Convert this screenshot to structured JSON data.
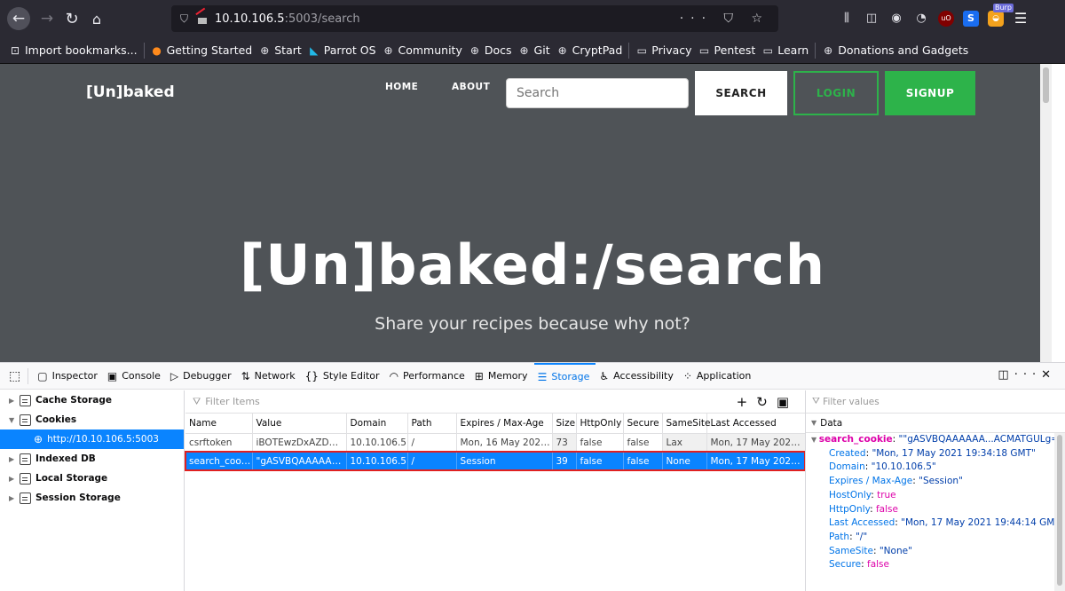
{
  "browser": {
    "url_host": "10.10.106.5",
    "url_rest": ":5003/search",
    "url_actions": "··· ⛉ ☆",
    "burp_badge": "Burp",
    "bookmarks": [
      {
        "label": "Import bookmarks...",
        "icon": "import-icon"
      },
      {
        "label": "Getting Started",
        "icon": "firefox-icon"
      },
      {
        "label": "Start",
        "icon": "globe-icon"
      },
      {
        "label": "Parrot OS",
        "icon": "parrot-icon"
      },
      {
        "label": "Community",
        "icon": "globe-icon"
      },
      {
        "label": "Docs",
        "icon": "globe-icon"
      },
      {
        "label": "Git",
        "icon": "globe-icon"
      },
      {
        "label": "CryptPad",
        "icon": "globe-icon"
      },
      {
        "label": "Privacy",
        "icon": "folder-icon"
      },
      {
        "label": "Pentest",
        "icon": "folder-icon"
      },
      {
        "label": "Learn",
        "icon": "folder-icon"
      },
      {
        "label": "Donations and Gadgets",
        "icon": "globe-icon"
      }
    ]
  },
  "site": {
    "brand": "[Un]baked",
    "nav_home": "HOME",
    "nav_about": "ABOUT",
    "search_placeholder": "Search",
    "search_button": "SEARCH",
    "login_button": "LOGIN",
    "signup_button": "SIGNUP",
    "hero_title": "[Un]baked:/search",
    "hero_subtitle": "Share your recipes because why not?",
    "accent": "#2db34a"
  },
  "devtools": {
    "tabs": [
      {
        "label": "Inspector",
        "icon": "inspector-icon"
      },
      {
        "label": "Console",
        "icon": "console-icon"
      },
      {
        "label": "Debugger",
        "icon": "debugger-icon"
      },
      {
        "label": "Network",
        "icon": "network-icon"
      },
      {
        "label": "Style Editor",
        "icon": "style-editor-icon"
      },
      {
        "label": "Performance",
        "icon": "performance-icon"
      },
      {
        "label": "Memory",
        "icon": "memory-icon"
      },
      {
        "label": "Storage",
        "icon": "storage-icon"
      },
      {
        "label": "Accessibility",
        "icon": "accessibility-icon"
      },
      {
        "label": "Application",
        "icon": "application-icon"
      }
    ],
    "selected_tab": "Storage",
    "tree": {
      "cache_storage": "Cache Storage",
      "cookies": "Cookies",
      "cookie_host": "http://10.10.106.5:5003",
      "indexed_db": "Indexed DB",
      "local_storage": "Local Storage",
      "session_storage": "Session Storage"
    },
    "filter_placeholder": "Filter Items",
    "columns": [
      "Name",
      "Value",
      "Domain",
      "Path",
      "Expires / Max-Age",
      "Size",
      "HttpOnly",
      "Secure",
      "SameSite",
      "Last Accessed"
    ],
    "rows": [
      [
        "csrftoken",
        "iBOTEwzDxAZDM...",
        "10.10.106.5",
        "/",
        "Mon, 16 May 20221...",
        "73",
        "false",
        "false",
        "Lax",
        "Mon, 17 May 20211..."
      ],
      [
        "search_cookie",
        "\"gASVBQAAAAAA...",
        "10.10.106.5",
        "/",
        "Session",
        "39",
        "false",
        "false",
        "None",
        "Mon, 17 May 20211..."
      ]
    ],
    "details": {
      "filter_placeholder": "Filter values",
      "section": "Data",
      "root_key": "search_cookie",
      "root_val": "\"\"gASVBQAAAAAA...ACMATGULg==\"\"",
      "fields": [
        {
          "key": "Created",
          "val": "\"Mon, 17 May 2021 19:34:18 GMT\"",
          "kind": "str"
        },
        {
          "key": "Domain",
          "val": "\"10.10.106.5\"",
          "kind": "str"
        },
        {
          "key": "Expires / Max-Age",
          "val": "\"Session\"",
          "kind": "str"
        },
        {
          "key": "HostOnly",
          "val": "true",
          "kind": "bool"
        },
        {
          "key": "HttpOnly",
          "val": "false",
          "kind": "bool"
        },
        {
          "key": "Last Accessed",
          "val": "\"Mon, 17 May 2021 19:44:14 GMT\"",
          "kind": "str"
        },
        {
          "key": "Path",
          "val": "\"/\"",
          "kind": "str"
        },
        {
          "key": "SameSite",
          "val": "\"None\"",
          "kind": "str"
        },
        {
          "key": "Secure",
          "val": "false",
          "kind": "bool"
        }
      ]
    }
  }
}
